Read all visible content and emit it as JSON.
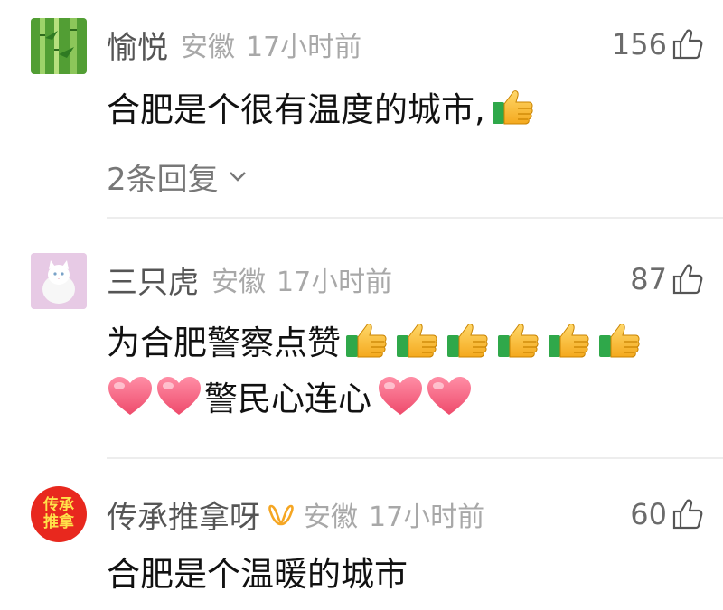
{
  "comments": [
    {
      "username": "愉悦",
      "location": "安徽",
      "time": "17小时前",
      "likes": "156",
      "text": "合肥是个很有温度的城市,",
      "replies": "2条回复"
    },
    {
      "username": "三只虎",
      "location": "安徽",
      "time": "17小时前",
      "likes": "87",
      "text_line1": "为合肥警察点赞",
      "text_line2": "警民心连心"
    },
    {
      "username": "传承推拿呀",
      "location": "安徽",
      "time": "17小时前",
      "likes": "60",
      "text": "合肥是个温暖的城市",
      "avatar_text": [
        "传承",
        "推拿"
      ]
    }
  ],
  "colors": {
    "avatar3_bg": "#e8281e",
    "avatar3_text": "#ffe24a",
    "vip_icon": "#f5a623",
    "heart": "#f25a7a"
  },
  "icons": {
    "like": "thumbs-up-outline-icon",
    "thumb_emoji": "thumbs-up-emoji-icon",
    "heart_emoji": "heart-emoji-icon",
    "expand": "chevron-down-icon",
    "vip": "vip-ribbon-icon"
  }
}
